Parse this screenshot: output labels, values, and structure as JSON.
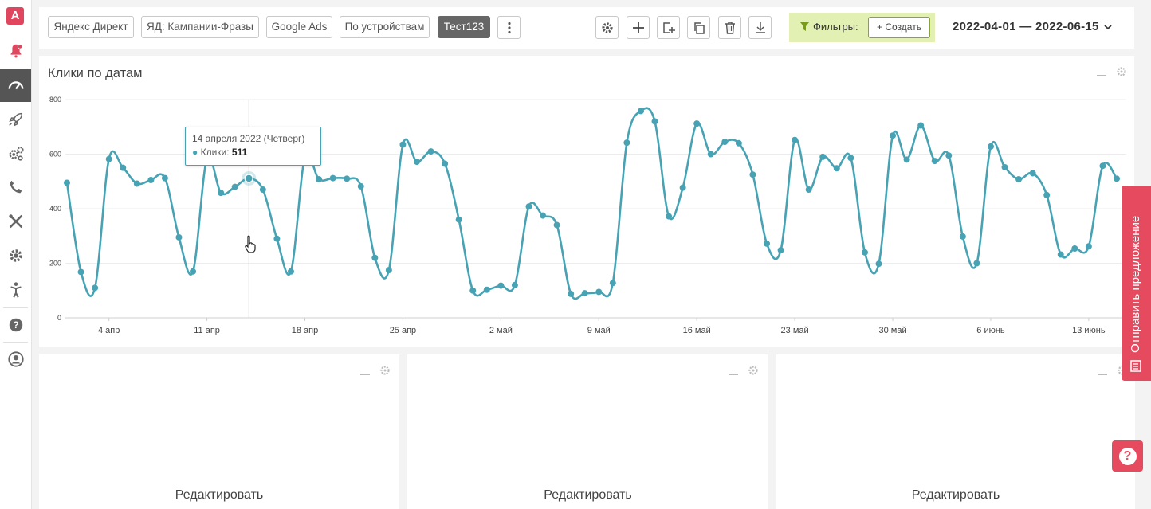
{
  "sidebar": {
    "logo": "A",
    "items": [
      {
        "icon": "bell-icon"
      },
      {
        "icon": "dashboard-gauge-icon"
      },
      {
        "icon": "rocket-icon"
      },
      {
        "icon": "gears-icon"
      },
      {
        "icon": "phone-icon"
      },
      {
        "icon": "tools-icon"
      },
      {
        "icon": "gear-icon"
      },
      {
        "icon": "person-icon"
      },
      {
        "icon": "help-icon"
      },
      {
        "icon": "user-avatar-icon"
      }
    ]
  },
  "toolbar": {
    "tabs": [
      "Яндекс Директ",
      "ЯД: Кампании-Фразы",
      "Google Ads",
      "По устройствам",
      "Тест123"
    ],
    "active_tab": "Тест123",
    "filters_label": "Фильтры:",
    "create_label": "Создать",
    "date_range": "2022-04-01 — 2022-06-15"
  },
  "chart_panel": {
    "title": "Клики по датам",
    "tooltip": {
      "date": "14 апреля 2022 (Четверг)",
      "series": "Клики",
      "value": "511"
    }
  },
  "chart_data": {
    "type": "line",
    "title": "Клики по датам",
    "series": [
      {
        "name": "Клики",
        "color": "#47a3b4",
        "values": [
          495,
          168,
          110,
          582,
          550,
          492,
          505,
          512,
          295,
          170,
          583,
          458,
          480,
          511,
          470,
          290,
          170,
          588,
          508,
          512,
          510,
          482,
          220,
          175,
          635,
          572,
          610,
          565,
          360,
          100,
          103,
          118,
          120,
          408,
          375,
          340,
          88,
          90,
          95,
          128,
          642,
          758,
          720,
          372,
          477,
          712,
          600,
          645,
          640,
          525,
          272,
          248,
          652,
          470,
          590,
          548,
          586,
          240,
          198,
          668,
          580,
          705,
          575,
          595,
          298,
          200,
          628,
          552,
          508,
          530,
          450,
          232,
          254,
          262,
          557,
          510
        ]
      }
    ],
    "x_start": "2022-04-01",
    "x_end": "2022-06-15",
    "x_tick_labels": [
      "4 апр",
      "11 апр",
      "18 апр",
      "25 апр",
      "2 май",
      "9 май",
      "16 май",
      "23 май",
      "30 май",
      "6 июнь",
      "13 июнь"
    ],
    "y_tick_labels": [
      "0",
      "200",
      "400",
      "600",
      "800"
    ],
    "ylim": [
      0,
      800
    ],
    "grid": true
  },
  "widgets": [
    {
      "edit_label": "Редактировать"
    },
    {
      "edit_label": "Редактировать"
    },
    {
      "edit_label": "Редактировать"
    }
  ],
  "feedback_label": "Отправить предложение",
  "help_label": "?"
}
